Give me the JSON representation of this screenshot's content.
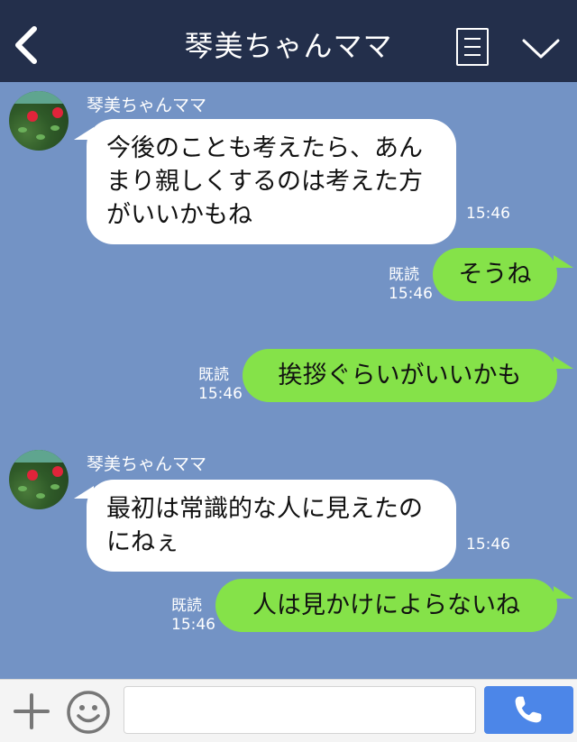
{
  "header": {
    "title": "琴美ちゃんママ",
    "back_icon": "chevron-left-icon",
    "menu_icon": "menu-list-icon",
    "collapse_icon": "chevron-down-icon"
  },
  "messages": [
    {
      "sender": "琴美ちゃんママ",
      "text": "今後のことも考えたら、あんまり親しくするのは考えた方がいいかもね",
      "time": "15:46"
    },
    {
      "read": "既読",
      "time": "15:46",
      "text": "そうね"
    },
    {
      "read": "既読",
      "time": "15:46",
      "text": "挨拶ぐらいがいいかも"
    },
    {
      "sender": "琴美ちゃんママ",
      "text": "最初は常識的な人に見えたのにねぇ",
      "time": "15:46"
    },
    {
      "read": "既読",
      "time": "15:46",
      "text": "人は見かけによらないね"
    }
  ],
  "input_bar": {
    "add_icon": "plus-icon",
    "emoji_icon": "smiley-icon",
    "message_value": "",
    "call_icon": "phone-icon"
  },
  "colors": {
    "header_bg": "#232f4b",
    "chat_bg": "#7393c5",
    "incoming_bubble": "#ffffff",
    "outgoing_bubble": "#85e249",
    "call_button": "#4c86e8"
  }
}
